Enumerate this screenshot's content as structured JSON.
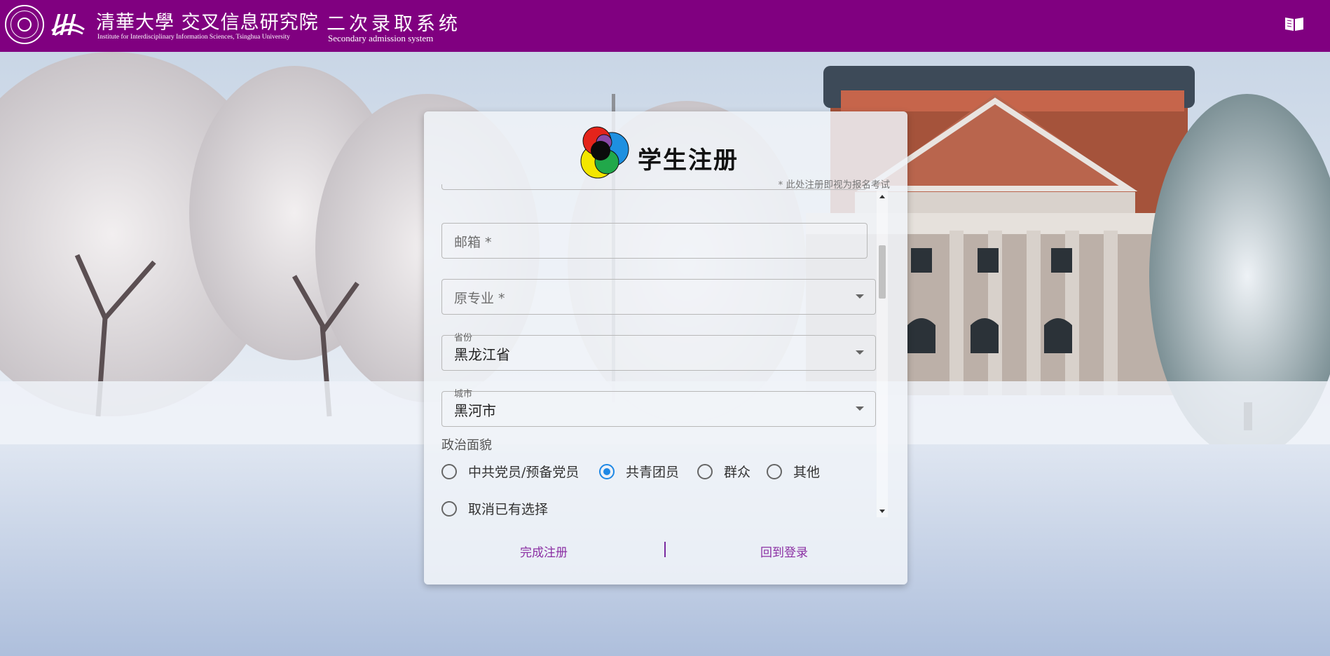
{
  "header": {
    "brand_title": "清華大學 交叉信息研究院",
    "brand_subtitle": "Institute for Interdisciplinary Information Sciences, Tsinghua University",
    "system_title": "二次录取系统",
    "system_subtitle": "Secondary admission system",
    "background_color": "#800080"
  },
  "card": {
    "title": "学生注册",
    "notice": "* 此处注册即视为报名考试",
    "fields": {
      "email_placeholder": "邮箱 *",
      "major_placeholder": "原专业 *",
      "province_label": "省份",
      "province_value": "黑龙江省",
      "city_label": "城市",
      "city_value": "黑河市"
    },
    "political_status": {
      "label": "政治面貌",
      "options": [
        "中共党员/预备党员",
        "共青团员",
        "群众",
        "其他"
      ],
      "selected": "共青团员",
      "clear_label": "取消已有选择"
    },
    "actions": {
      "submit": "完成注册",
      "back": "回到登录"
    },
    "accent_color": "#8b2fa3",
    "radio_checked_color": "#1e88e5"
  },
  "icons": [
    "university-seal-icon",
    "iiis-logo-icon",
    "book-icon",
    "color-circles-logo-icon"
  ]
}
